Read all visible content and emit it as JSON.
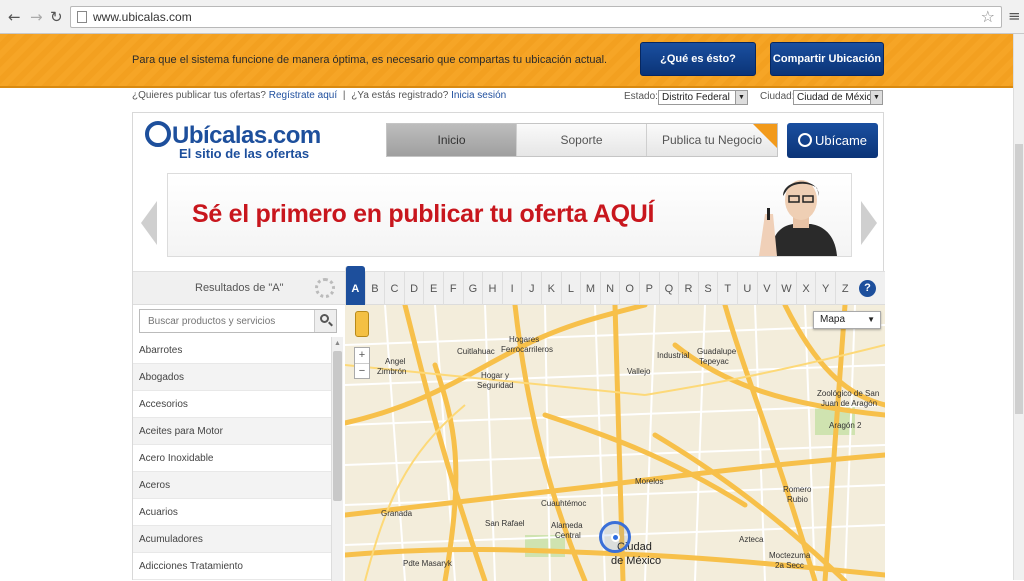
{
  "browser": {
    "url": "www.ubicalas.com"
  },
  "location_bar": {
    "message": "Para que el sistema funcione de manera óptima, es necesario que compartas tu ubicación actual.",
    "what_button": "¿Qué es ésto?",
    "share_button": "Compartir Ubicación"
  },
  "top_links": {
    "publish_question": "¿Quieres publicar tus ofertas?",
    "register_link": "Regístrate aquí",
    "separator": "|",
    "registered_question": "¿Ya estás registrado?",
    "login_link": "Inicia sesión",
    "state_label": "Estado:",
    "state_value": "Distrito Federal",
    "city_label": "Ciudad:",
    "city_value": "Ciudad de Méxic"
  },
  "header": {
    "logo_main": "Ubícalas.com",
    "logo_sub": "El sitio de las ofertas",
    "tabs": [
      {
        "label": "Inicio"
      },
      {
        "label": "Soporte"
      },
      {
        "label": "Publica tu Negocio"
      }
    ],
    "ubicame": "Ubícame"
  },
  "banner": {
    "text": "Sé el primero en publicar tu oferta AQUÍ"
  },
  "letters_bar": {
    "results_label": "Resultados de \"A\"",
    "letters": [
      "A",
      "B",
      "C",
      "D",
      "E",
      "F",
      "G",
      "H",
      "I",
      "J",
      "K",
      "L",
      "M",
      "N",
      "O",
      "P",
      "Q",
      "R",
      "S",
      "T",
      "U",
      "V",
      "W",
      "X",
      "Y",
      "Z"
    ],
    "active": "A",
    "help": "?"
  },
  "sidebar": {
    "search_placeholder": "Buscar productos y servicios",
    "categories": [
      "Abarrotes",
      "Abogados",
      "Accesorios",
      "Aceites para Motor",
      "Acero Inoxidable",
      "Aceros",
      "Acuarios",
      "Acumuladores",
      "Adicciones Tratamiento"
    ]
  },
  "map": {
    "type_selector": "Mapa",
    "zoom_in": "+",
    "zoom_out": "−",
    "labels": [
      {
        "text": "Hogares"
      },
      {
        "text": "Ferrocarrileros"
      },
      {
        "text": "Industrial"
      },
      {
        "text": "Angel"
      },
      {
        "text": "Zimbrón"
      },
      {
        "text": "Cuitlahuac"
      },
      {
        "text": "Hogar y"
      },
      {
        "text": "Seguridad"
      },
      {
        "text": "Vallejo"
      },
      {
        "text": "Guadalupe"
      },
      {
        "text": "Tepeyac"
      },
      {
        "text": "Zoológico de San"
      },
      {
        "text": "Juan de Aragón"
      },
      {
        "text": "Morelos"
      },
      {
        "text": "Cuauhtémoc"
      },
      {
        "text": "Granada"
      },
      {
        "text": "San Rafael"
      },
      {
        "text": "Alameda"
      },
      {
        "text": "Central"
      },
      {
        "text": "Ciudad"
      },
      {
        "text": "de México"
      },
      {
        "text": "Azteca"
      },
      {
        "text": "Romero"
      },
      {
        "text": "Rubio"
      },
      {
        "text": "Moctezuma"
      },
      {
        "text": "2a Secc"
      },
      {
        "text": "Pdte Masaryk"
      },
      {
        "text": "Aragón 2"
      }
    ]
  }
}
